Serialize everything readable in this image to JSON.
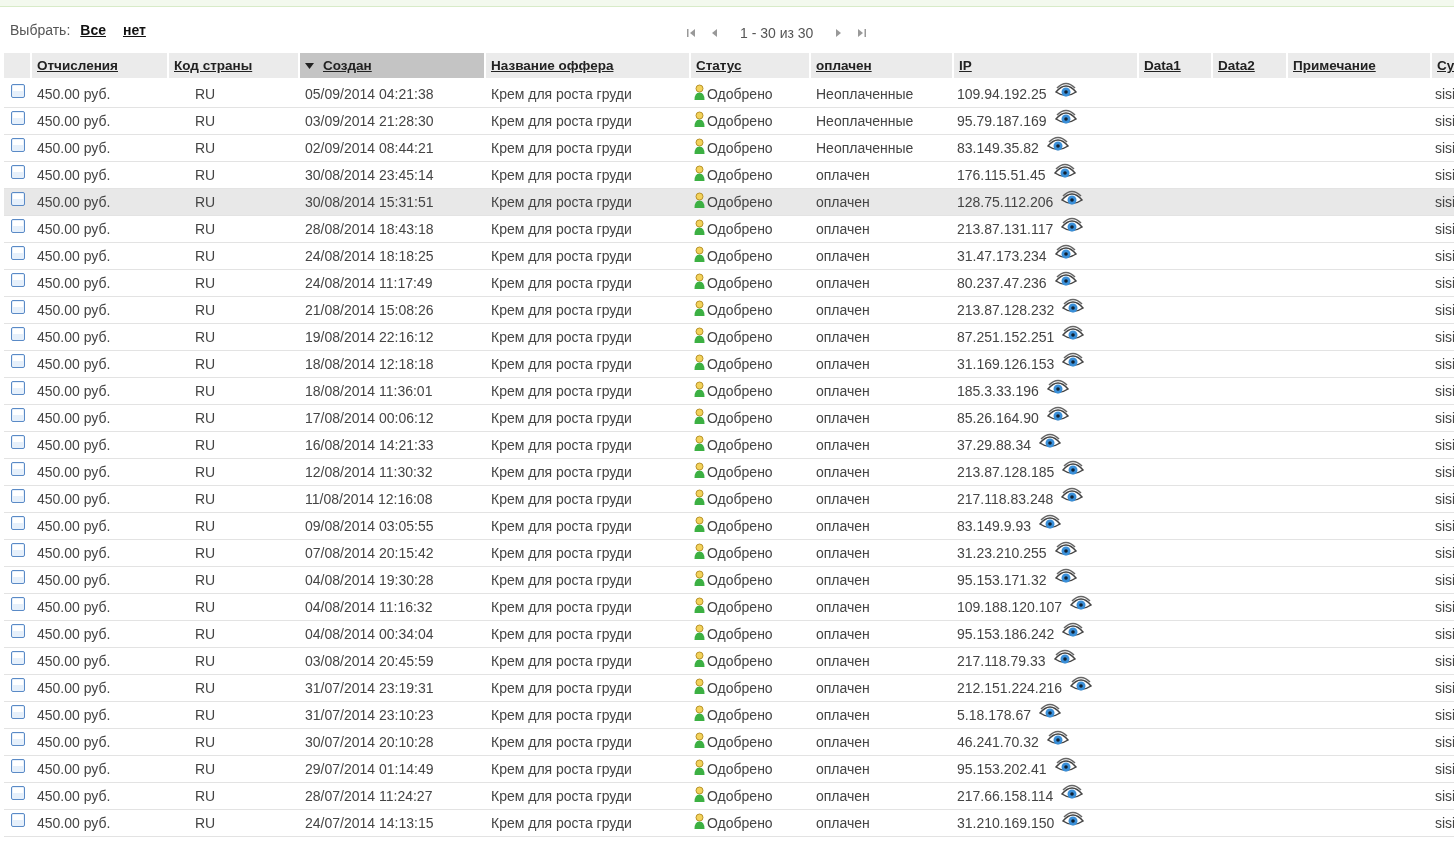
{
  "select": {
    "label": "Выбрать:",
    "links": [
      "Все",
      "нет"
    ]
  },
  "pager": {
    "range": "1 - 30 из 30"
  },
  "columns": [
    {
      "label": "Отчисления",
      "sorted": false
    },
    {
      "label": "Код страны",
      "sorted": false
    },
    {
      "label": "Создан",
      "sorted": true
    },
    {
      "label": "Название оффера",
      "sorted": false
    },
    {
      "label": "Статус",
      "sorted": false
    },
    {
      "label": "оплачен",
      "sorted": false
    },
    {
      "label": "IP",
      "sorted": false
    },
    {
      "label": "Data1",
      "sorted": false
    },
    {
      "label": "Data2",
      "sorted": false
    },
    {
      "label": "Примечание",
      "sorted": false
    },
    {
      "label": "Су",
      "sorted": false
    }
  ],
  "rows": [
    {
      "selected": false,
      "cells": [
        "450.00 руб.",
        "RU",
        "05/09/2014 04:21:38",
        "Крем для роста груди",
        "Одобрено",
        "Неоплаченные",
        "109.94.192.25",
        "sisi"
      ]
    },
    {
      "selected": false,
      "cells": [
        "450.00 руб.",
        "RU",
        "03/09/2014 21:28:30",
        "Крем для роста груди",
        "Одобрено",
        "Неоплаченные",
        "95.79.187.169",
        "sisi"
      ]
    },
    {
      "selected": false,
      "cells": [
        "450.00 руб.",
        "RU",
        "02/09/2014 08:44:21",
        "Крем для роста груди",
        "Одобрено",
        "Неоплаченные",
        "83.149.35.82",
        "sisi"
      ]
    },
    {
      "selected": false,
      "cells": [
        "450.00 руб.",
        "RU",
        "30/08/2014 23:45:14",
        "Крем для роста груди",
        "Одобрено",
        "оплачен",
        "176.115.51.45",
        "sisi"
      ]
    },
    {
      "selected": true,
      "cells": [
        "450.00 руб.",
        "RU",
        "30/08/2014 15:31:51",
        "Крем для роста груди",
        "Одобрено",
        "оплачен",
        "128.75.112.206",
        "sisi"
      ]
    },
    {
      "selected": false,
      "cells": [
        "450.00 руб.",
        "RU",
        "28/08/2014 18:43:18",
        "Крем для роста груди",
        "Одобрено",
        "оплачен",
        "213.87.131.117",
        "sisi"
      ]
    },
    {
      "selected": false,
      "cells": [
        "450.00 руб.",
        "RU",
        "24/08/2014 18:18:25",
        "Крем для роста груди",
        "Одобрено",
        "оплачен",
        "31.47.173.234",
        "sisi"
      ]
    },
    {
      "selected": false,
      "cells": [
        "450.00 руб.",
        "RU",
        "24/08/2014 11:17:49",
        "Крем для роста груди",
        "Одобрено",
        "оплачен",
        "80.237.47.236",
        "sisi"
      ]
    },
    {
      "selected": false,
      "cells": [
        "450.00 руб.",
        "RU",
        "21/08/2014 15:08:26",
        "Крем для роста груди",
        "Одобрено",
        "оплачен",
        "213.87.128.232",
        "sisi"
      ]
    },
    {
      "selected": false,
      "cells": [
        "450.00 руб.",
        "RU",
        "19/08/2014 22:16:12",
        "Крем для роста груди",
        "Одобрено",
        "оплачен",
        "87.251.152.251",
        "sisi"
      ]
    },
    {
      "selected": false,
      "cells": [
        "450.00 руб.",
        "RU",
        "18/08/2014 12:18:18",
        "Крем для роста груди",
        "Одобрено",
        "оплачен",
        "31.169.126.153",
        "sisi"
      ]
    },
    {
      "selected": false,
      "cells": [
        "450.00 руб.",
        "RU",
        "18/08/2014 11:36:01",
        "Крем для роста груди",
        "Одобрено",
        "оплачен",
        "185.3.33.196",
        "sisi"
      ]
    },
    {
      "selected": false,
      "cells": [
        "450.00 руб.",
        "RU",
        "17/08/2014 00:06:12",
        "Крем для роста груди",
        "Одобрено",
        "оплачен",
        "85.26.164.90",
        "sisi"
      ]
    },
    {
      "selected": false,
      "cells": [
        "450.00 руб.",
        "RU",
        "16/08/2014 14:21:33",
        "Крем для роста груди",
        "Одобрено",
        "оплачен",
        "37.29.88.34",
        "sisi"
      ]
    },
    {
      "selected": false,
      "cells": [
        "450.00 руб.",
        "RU",
        "12/08/2014 11:30:32",
        "Крем для роста груди",
        "Одобрено",
        "оплачен",
        "213.87.128.185",
        "sisi"
      ]
    },
    {
      "selected": false,
      "cells": [
        "450.00 руб.",
        "RU",
        "11/08/2014 12:16:08",
        "Крем для роста груди",
        "Одобрено",
        "оплачен",
        "217.118.83.248",
        "sisi"
      ]
    },
    {
      "selected": false,
      "cells": [
        "450.00 руб.",
        "RU",
        "09/08/2014 03:05:55",
        "Крем для роста груди",
        "Одобрено",
        "оплачен",
        "83.149.9.93",
        "sisi"
      ]
    },
    {
      "selected": false,
      "cells": [
        "450.00 руб.",
        "RU",
        "07/08/2014 20:15:42",
        "Крем для роста груди",
        "Одобрено",
        "оплачен",
        "31.23.210.255",
        "sisi"
      ]
    },
    {
      "selected": false,
      "cells": [
        "450.00 руб.",
        "RU",
        "04/08/2014 19:30:28",
        "Крем для роста груди",
        "Одобрено",
        "оплачен",
        "95.153.171.32",
        "sisi"
      ]
    },
    {
      "selected": false,
      "cells": [
        "450.00 руб.",
        "RU",
        "04/08/2014 11:16:32",
        "Крем для роста груди",
        "Одобрено",
        "оплачен",
        "109.188.120.107",
        "sisi"
      ]
    },
    {
      "selected": false,
      "cells": [
        "450.00 руб.",
        "RU",
        "04/08/2014 00:34:04",
        "Крем для роста груди",
        "Одобрено",
        "оплачен",
        "95.153.186.242",
        "sisi"
      ]
    },
    {
      "selected": false,
      "cells": [
        "450.00 руб.",
        "RU",
        "03/08/2014 20:45:59",
        "Крем для роста груди",
        "Одобрено",
        "оплачен",
        "217.118.79.33",
        "sisi"
      ]
    },
    {
      "selected": false,
      "cells": [
        "450.00 руб.",
        "RU",
        "31/07/2014 23:19:31",
        "Крем для роста груди",
        "Одобрено",
        "оплачен",
        "212.151.224.216",
        "sisi"
      ]
    },
    {
      "selected": false,
      "cells": [
        "450.00 руб.",
        "RU",
        "31/07/2014 23:10:23",
        "Крем для роста груди",
        "Одобрено",
        "оплачен",
        "5.18.178.67",
        "sisi"
      ]
    },
    {
      "selected": false,
      "cells": [
        "450.00 руб.",
        "RU",
        "30/07/2014 20:10:28",
        "Крем для роста груди",
        "Одобрено",
        "оплачен",
        "46.241.70.32",
        "sisi"
      ]
    },
    {
      "selected": false,
      "cells": [
        "450.00 руб.",
        "RU",
        "29/07/2014 01:14:49",
        "Крем для роста груди",
        "Одобрено",
        "оплачен",
        "95.153.202.41",
        "sisi"
      ]
    },
    {
      "selected": false,
      "cells": [
        "450.00 руб.",
        "RU",
        "28/07/2014 11:24:27",
        "Крем для роста груди",
        "Одобрено",
        "оплачен",
        "217.66.158.114",
        "sisi"
      ]
    },
    {
      "selected": false,
      "cells": [
        "450.00 руб.",
        "RU",
        "24/07/2014 14:13:15",
        "Крем для роста груди",
        "Одобрено",
        "оплачен",
        "31.210.169.150",
        "sisi"
      ]
    }
  ]
}
